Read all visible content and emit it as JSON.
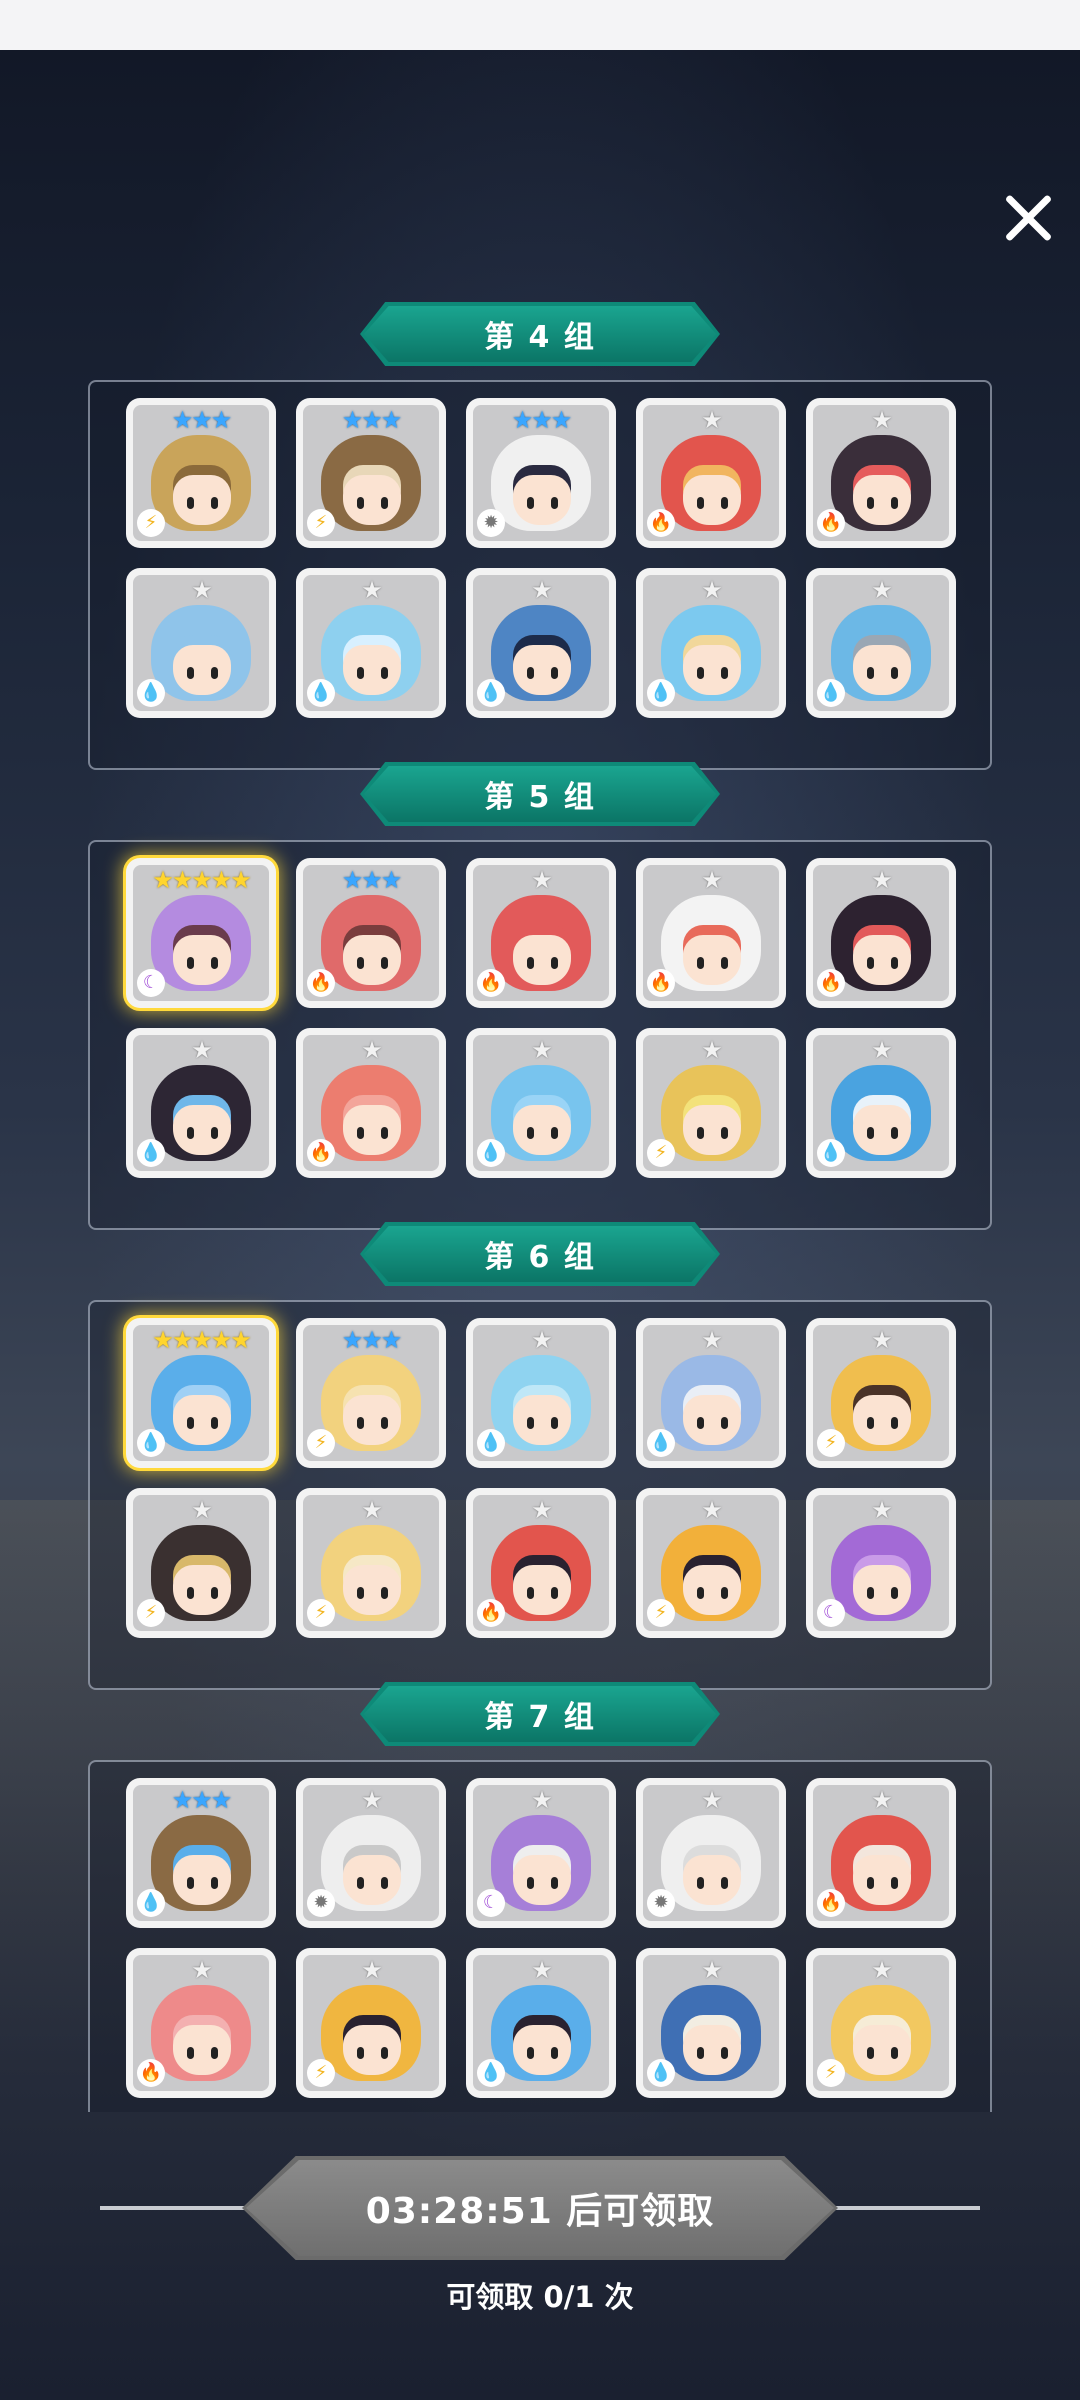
{
  "colors": {
    "banner": "#0e8a78",
    "gold_glow": "#ffd93b",
    "blue_star": "#3aa6ff"
  },
  "groups": [
    {
      "label": "第 4 组",
      "cards": [
        {
          "stars": "★★★",
          "tier": "blue",
          "element": "lightning",
          "hair": "#c9a45a",
          "acc": "#8b6a3a"
        },
        {
          "stars": "★★★",
          "tier": "blue",
          "element": "lightning",
          "hair": "#8a6a44",
          "acc": "#e8d7b8"
        },
        {
          "stars": "★★★",
          "tier": "blue",
          "element": "light",
          "hair": "#f0f0f0",
          "acc": "#2a2a40"
        },
        {
          "stars": "★",
          "tier": "white",
          "element": "fire",
          "hair": "#e2554d",
          "acc": "#f1b55f"
        },
        {
          "stars": "★",
          "tier": "white",
          "element": "fire",
          "hair": "#3a2e3a",
          "acc": "#e55c5c"
        },
        {
          "stars": "★",
          "tier": "white",
          "element": "water",
          "hair": "#8fc4ea",
          "acc": "#8fc4ea"
        },
        {
          "stars": "★",
          "tier": "white",
          "element": "water",
          "hair": "#8ed0ef",
          "acc": "#d8f0ff"
        },
        {
          "stars": "★",
          "tier": "white",
          "element": "water",
          "hair": "#4e85c4",
          "acc": "#1d2b4a"
        },
        {
          "stars": "★",
          "tier": "white",
          "element": "water",
          "hair": "#7cc9ef",
          "acc": "#f1d79a"
        },
        {
          "stars": "★",
          "tier": "white",
          "element": "water",
          "hair": "#6cb8e6",
          "acc": "#9aa7b4"
        }
      ]
    },
    {
      "label": "第 5 组",
      "cards": [
        {
          "stars": "★★★★★",
          "tier": "gold",
          "element": "dark",
          "hair": "#b48be0",
          "acc": "#6a3c4c"
        },
        {
          "stars": "★★★",
          "tier": "blue",
          "element": "fire",
          "hair": "#e06a6a",
          "acc": "#7a3d3d"
        },
        {
          "stars": "★",
          "tier": "white",
          "element": "fire",
          "hair": "#e25a5a",
          "acc": "#e25a5a"
        },
        {
          "stars": "★",
          "tier": "white",
          "element": "fire",
          "hair": "#f3f3f3",
          "acc": "#e86a5a"
        },
        {
          "stars": "★",
          "tier": "white",
          "element": "fire",
          "hair": "#2d2230",
          "acc": "#e25a5a"
        },
        {
          "stars": "★",
          "tier": "white",
          "element": "water",
          "hair": "#2d2634",
          "acc": "#6fb7e9"
        },
        {
          "stars": "★",
          "tier": "white",
          "element": "fire",
          "hair": "#ec7d6f",
          "acc": "#f3a59a"
        },
        {
          "stars": "★",
          "tier": "white",
          "element": "water",
          "hair": "#78c4ee",
          "acc": "#9ad4f6"
        },
        {
          "stars": "★",
          "tier": "white",
          "element": "lightning",
          "hair": "#e8c35a",
          "acc": "#f3e27a"
        },
        {
          "stars": "★",
          "tier": "white",
          "element": "water",
          "hair": "#4aa3e0",
          "acc": "#e8f2fa"
        }
      ]
    },
    {
      "label": "第 6 组",
      "cards": [
        {
          "stars": "★★★★★",
          "tier": "gold",
          "element": "water",
          "hair": "#5aaeea",
          "acc": "#9fd0f5"
        },
        {
          "stars": "★★★",
          "tier": "blue",
          "element": "lightning",
          "hair": "#f2d27e",
          "acc": "#f6e2b0"
        },
        {
          "stars": "★",
          "tier": "white",
          "element": "water",
          "hair": "#8fd3f0",
          "acc": "#bfe7f7"
        },
        {
          "stars": "★",
          "tier": "white",
          "element": "water",
          "hair": "#9ab9e6",
          "acc": "#e9eef6"
        },
        {
          "stars": "★",
          "tier": "white",
          "element": "lightning",
          "hair": "#f0be4e",
          "acc": "#4a3328"
        },
        {
          "stars": "★",
          "tier": "white",
          "element": "lightning",
          "hair": "#3a3030",
          "acc": "#d8b86a"
        },
        {
          "stars": "★",
          "tier": "white",
          "element": "lightning",
          "hair": "#f2d27e",
          "acc": "#f6e8c6"
        },
        {
          "stars": "★",
          "tier": "white",
          "element": "fire",
          "hair": "#e2554d",
          "acc": "#2a2230"
        },
        {
          "stars": "★",
          "tier": "white",
          "element": "lightning",
          "hair": "#f2b03a",
          "acc": "#2a2230"
        },
        {
          "stars": "★",
          "tier": "white",
          "element": "dark",
          "hair": "#a36ad6",
          "acc": "#c99be8"
        }
      ]
    },
    {
      "label": "第 7 组",
      "cards": [
        {
          "stars": "★★★",
          "tier": "blue",
          "element": "water",
          "hair": "#8a6a44",
          "acc": "#5aaeea"
        },
        {
          "stars": "★",
          "tier": "white",
          "element": "light",
          "hair": "#eeeeee",
          "acc": "#c9c9c9"
        },
        {
          "stars": "★",
          "tier": "white",
          "element": "dark",
          "hair": "#a67fd8",
          "acc": "#eeeeee"
        },
        {
          "stars": "★",
          "tier": "white",
          "element": "light",
          "hair": "#efefef",
          "acc": "#dcdcdc"
        },
        {
          "stars": "★",
          "tier": "white",
          "element": "fire",
          "hair": "#e2554d",
          "acc": "#f3e6dc"
        },
        {
          "stars": "★",
          "tier": "white",
          "element": "fire",
          "hair": "#ee8a8a",
          "acc": "#f3b0b0"
        },
        {
          "stars": "★",
          "tier": "white",
          "element": "lightning",
          "hair": "#f0b640",
          "acc": "#2a2230"
        },
        {
          "stars": "★",
          "tier": "white",
          "element": "water",
          "hair": "#5aaeea",
          "acc": "#2a2230"
        },
        {
          "stars": "★",
          "tier": "white",
          "element": "water",
          "hair": "#3f6fb4",
          "acc": "#f2ede2"
        },
        {
          "stars": "★",
          "tier": "white",
          "element": "lightning",
          "hair": "#f2c860",
          "acc": "#f6ecd6"
        }
      ]
    }
  ],
  "element_icons": {
    "water": {
      "glyph": "💧",
      "name": "water-element-icon",
      "color": "#2f8fe8"
    },
    "fire": {
      "glyph": "🔥",
      "name": "fire-element-icon",
      "color": "#e8532f"
    },
    "lightning": {
      "glyph": "⚡",
      "name": "lightning-element-icon",
      "color": "#f2b41e"
    },
    "light": {
      "glyph": "✹",
      "name": "light-element-icon",
      "color": "#777777"
    },
    "dark": {
      "glyph": "☾",
      "name": "dark-element-icon",
      "color": "#a24fd8"
    }
  },
  "footer": {
    "claim_button_label": "03:28:51 后可领取",
    "claim_count_text": "可领取 0/1 次"
  }
}
